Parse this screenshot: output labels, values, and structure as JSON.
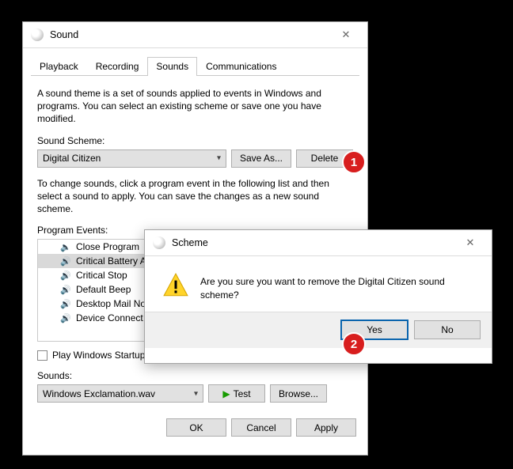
{
  "sound": {
    "title": "Sound",
    "tabs": [
      "Playback",
      "Recording",
      "Sounds",
      "Communications"
    ],
    "active_tab": 2,
    "theme_desc": "A sound theme is a set of sounds applied to events in Windows and programs.  You can select an existing scheme or save one you have modified.",
    "scheme_label": "Sound Scheme:",
    "scheme_value": "Digital Citizen",
    "save_as": "Save As...",
    "delete": "Delete",
    "change_desc": "To change sounds, click a program event in the following list and then select a sound to apply.  You can save the changes as a new sound scheme.",
    "events_label": "Program Events:",
    "events": [
      {
        "label": "Close Program",
        "has_sound": false,
        "selected": false
      },
      {
        "label": "Critical Battery Alarm",
        "has_sound": true,
        "selected": true
      },
      {
        "label": "Critical Stop",
        "has_sound": true,
        "selected": false
      },
      {
        "label": "Default Beep",
        "has_sound": true,
        "selected": false
      },
      {
        "label": "Desktop Mail Notification",
        "has_sound": true,
        "selected": false
      },
      {
        "label": "Device Connect",
        "has_sound": true,
        "selected": false
      }
    ],
    "startup_label": "Play Windows Startup sound",
    "startup_checked": false,
    "sounds_label": "Sounds:",
    "sounds_value": "Windows Exclamation.wav",
    "test": "Test",
    "browse": "Browse...",
    "ok": "OK",
    "cancel": "Cancel",
    "apply": "Apply"
  },
  "scheme_dialog": {
    "title": "Scheme",
    "message": "Are you sure you want to remove the Digital Citizen sound scheme?",
    "yes": "Yes",
    "no": "No"
  },
  "callouts": {
    "one": "1",
    "two": "2"
  }
}
